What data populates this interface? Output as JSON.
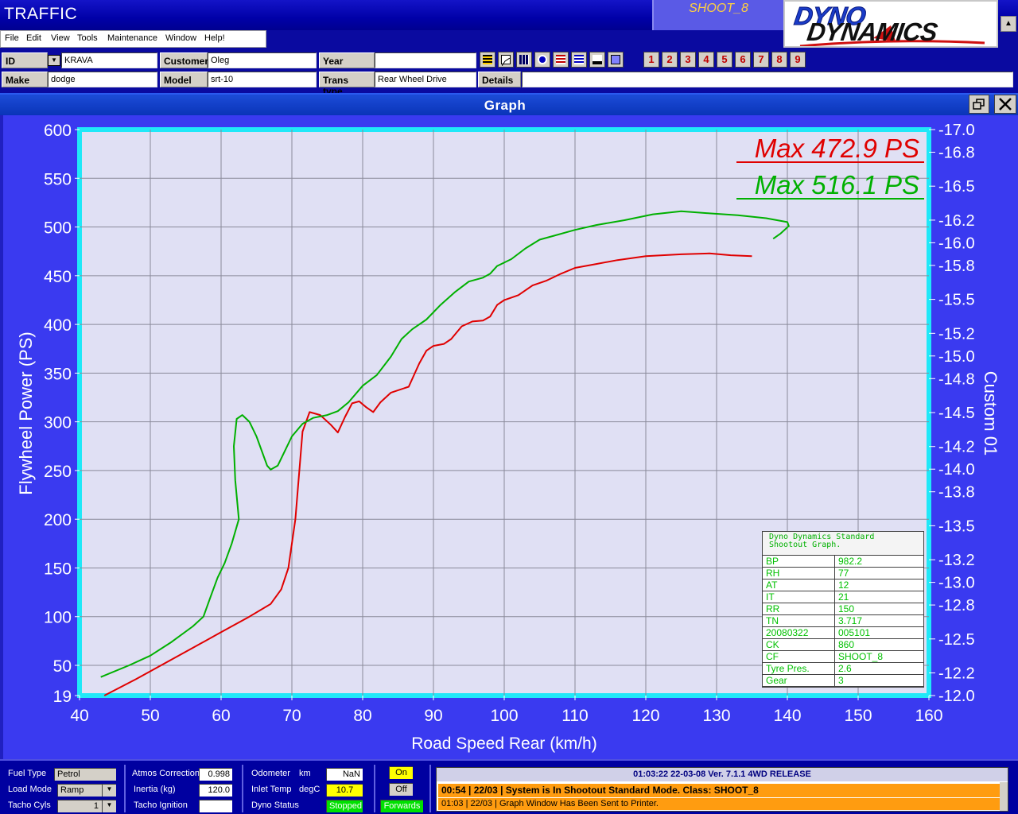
{
  "app": {
    "title": "TRAFFIC",
    "shootout_label": "SHOOT_8",
    "logo_line1": "DYNO",
    "logo_line2": "DYNAMICS"
  },
  "menu": [
    "File",
    "Edit",
    "View",
    "Tools",
    "Maintenance",
    "Window",
    "Help!"
  ],
  "vehicle": {
    "id_label": "ID",
    "id_value": "KRAVA",
    "customer_label": "Customer",
    "customer_value": "Oleg",
    "year_label": "Year",
    "year_value": "",
    "make_label": "Make",
    "make_value": "dodge",
    "model_label": "Model",
    "model_value": "srt-10",
    "trans_label": "Trans type",
    "trans_value": "Rear Wheel Drive",
    "details_label": "Details",
    "details_value": ""
  },
  "toolbar_icons": [
    "report-icon",
    "graph-icon",
    "table-icon",
    "gauge-icon",
    "list-icon",
    "compare-icon",
    "print-icon",
    "monitor-icon"
  ],
  "run_buttons": [
    "1",
    "2",
    "3",
    "4",
    "5",
    "6",
    "7",
    "8",
    "9"
  ],
  "graph_window": {
    "title": "Graph"
  },
  "chart_data": {
    "type": "line",
    "xlabel": "Road Speed Rear (km/h)",
    "ylabel": "Flywheel Power (PS)",
    "y2label": "Custom 01",
    "xlim": [
      40,
      160
    ],
    "ylim": [
      19,
      600
    ],
    "y2lim": [
      12.0,
      17.0
    ],
    "x_ticks": [
      "40",
      "50",
      "60",
      "70",
      "80",
      "90",
      "100",
      "110",
      "120",
      "130",
      "140",
      "150",
      "160"
    ],
    "y_ticks": [
      "600",
      "550",
      "500",
      "450",
      "400",
      "350",
      "300",
      "250",
      "200",
      "150",
      "100",
      "50",
      "19"
    ],
    "y2_ticks": [
      "17.0",
      "16.8",
      "16.5",
      "16.2",
      "16.0",
      "15.8",
      "15.5",
      "15.2",
      "15.0",
      "14.8",
      "14.5",
      "14.2",
      "14.0",
      "13.8",
      "13.5",
      "13.2",
      "13.0",
      "12.8",
      "12.5",
      "12.2",
      "12.0"
    ],
    "grid": true,
    "annotations": [
      "Max 472.9 PS",
      "Max 516.1 PS"
    ],
    "series": [
      {
        "color": "#e00000",
        "points": [
          [
            43.5,
            19
          ],
          [
            48,
            36
          ],
          [
            52,
            52
          ],
          [
            56,
            68
          ],
          [
            60,
            84
          ],
          [
            64,
            100
          ],
          [
            67,
            113
          ],
          [
            68.5,
            128
          ],
          [
            69.5,
            150
          ],
          [
            70.5,
            200
          ],
          [
            71,
            245
          ],
          [
            71.5,
            290
          ],
          [
            72.5,
            310
          ],
          [
            74,
            307
          ],
          [
            75.5,
            297
          ],
          [
            76.5,
            289
          ],
          [
            77.5,
            305
          ],
          [
            78.5,
            319
          ],
          [
            79.5,
            321
          ],
          [
            80.5,
            315
          ],
          [
            81.5,
            310
          ],
          [
            82.5,
            320
          ],
          [
            84,
            330
          ],
          [
            86.5,
            336
          ],
          [
            88,
            360
          ],
          [
            89,
            373
          ],
          [
            90,
            378
          ],
          [
            91.5,
            380
          ],
          [
            92.5,
            385
          ],
          [
            94,
            398
          ],
          [
            95.5,
            403
          ],
          [
            97,
            404
          ],
          [
            98,
            408
          ],
          [
            99,
            420
          ],
          [
            100,
            425
          ],
          [
            102,
            430
          ],
          [
            104,
            440
          ],
          [
            106,
            445
          ],
          [
            108,
            452
          ],
          [
            110,
            458
          ],
          [
            113,
            462
          ],
          [
            116,
            466
          ],
          [
            120,
            470
          ],
          [
            125,
            472
          ],
          [
            129,
            472.9
          ],
          [
            132,
            471
          ],
          [
            135,
            470
          ]
        ]
      },
      {
        "color": "#00b000",
        "points": [
          [
            43,
            38
          ],
          [
            47,
            50
          ],
          [
            50,
            60
          ],
          [
            53,
            74
          ],
          [
            56,
            90
          ],
          [
            57.5,
            100
          ],
          [
            58.5,
            120
          ],
          [
            59.5,
            140
          ],
          [
            60.5,
            155
          ],
          [
            61.5,
            175
          ],
          [
            62.5,
            200
          ],
          [
            62,
            240
          ],
          [
            61.8,
            275
          ],
          [
            62.2,
            303
          ],
          [
            63,
            307
          ],
          [
            64,
            300
          ],
          [
            65,
            285
          ],
          [
            66,
            265
          ],
          [
            66.5,
            255
          ],
          [
            67,
            251
          ],
          [
            68,
            255
          ],
          [
            69,
            270
          ],
          [
            70,
            285
          ],
          [
            71.5,
            298
          ],
          [
            73,
            304
          ],
          [
            75,
            307
          ],
          [
            76.5,
            311
          ],
          [
            78,
            320
          ],
          [
            80,
            337
          ],
          [
            82,
            348
          ],
          [
            84,
            367
          ],
          [
            85.5,
            385
          ],
          [
            87,
            395
          ],
          [
            89,
            405
          ],
          [
            91,
            420
          ],
          [
            93,
            433
          ],
          [
            95,
            444
          ],
          [
            97,
            448
          ],
          [
            98,
            452
          ],
          [
            99,
            460
          ],
          [
            101,
            467
          ],
          [
            103,
            478
          ],
          [
            105,
            487
          ],
          [
            107,
            491
          ],
          [
            110,
            497
          ],
          [
            113,
            502
          ],
          [
            117,
            507
          ],
          [
            121,
            513
          ],
          [
            125,
            516.1
          ],
          [
            129,
            514
          ],
          [
            133,
            512
          ],
          [
            137,
            509
          ],
          [
            140,
            505
          ],
          [
            140.2,
            501
          ],
          [
            139,
            493
          ],
          [
            138,
            488
          ]
        ]
      }
    ]
  },
  "legend_table": {
    "title_line1": "Dyno Dynamics Standard",
    "title_line2": "Shootout Graph.",
    "rows": [
      {
        "k": "BP",
        "v": "982.2"
      },
      {
        "k": "RH",
        "v": "77"
      },
      {
        "k": "AT",
        "v": "12"
      },
      {
        "k": "IT",
        "v": "21"
      },
      {
        "k": "RR",
        "v": "150"
      },
      {
        "k": "TN",
        "v": "3.717"
      },
      {
        "k": "20080322",
        "v": "005101"
      },
      {
        "k": "CK",
        "v": "860"
      },
      {
        "k": "CF",
        "v": "SHOOT_8"
      },
      {
        "k": "Tyre Pres.",
        "v": "2.6"
      },
      {
        "k": "Gear",
        "v": "3"
      }
    ]
  },
  "status": {
    "fuel_type_label": "Fuel Type",
    "fuel_type_value": "Petrol",
    "load_mode_label": "Load Mode",
    "load_mode_value": "Ramp",
    "tacho_cyls_label": "Tacho Cyls",
    "tacho_cyls_value": "1",
    "atmos_label": "Atmos Correction",
    "atmos_value": "0.998",
    "inertia_label": "Inertia (kg)",
    "inertia_value": "120.0",
    "tacho_ignition_label": "Tacho Ignition",
    "tacho_ignition_value": "",
    "odometer_label": "Odometer",
    "odometer_unit": "km",
    "odometer_value": "NaN",
    "inlet_label": "Inlet Temp",
    "inlet_unit": "degC",
    "inlet_value": "10.7",
    "dyno_status_label": "Dyno Status",
    "dyno_status_value": "Stopped",
    "on_label": "On",
    "off_label": "Off",
    "forwards_label": "Forwards",
    "msg_header": "01:03:22    22-03-08    Ver. 7.1.1  4WD  RELEASE",
    "msg_1": "00:54 | 22/03 | System is In Shootout Standard Mode. Class: SHOOT_8",
    "msg_2": "01:03 | 22/03 | Graph Window Has Been Sent to Printer."
  },
  "colors": {
    "background_blue": "#3a3af0",
    "plot_bg": "#e0e0f4",
    "plot_border": "#20e8f8",
    "red_run": "#e00000",
    "green_run": "#00b000"
  }
}
